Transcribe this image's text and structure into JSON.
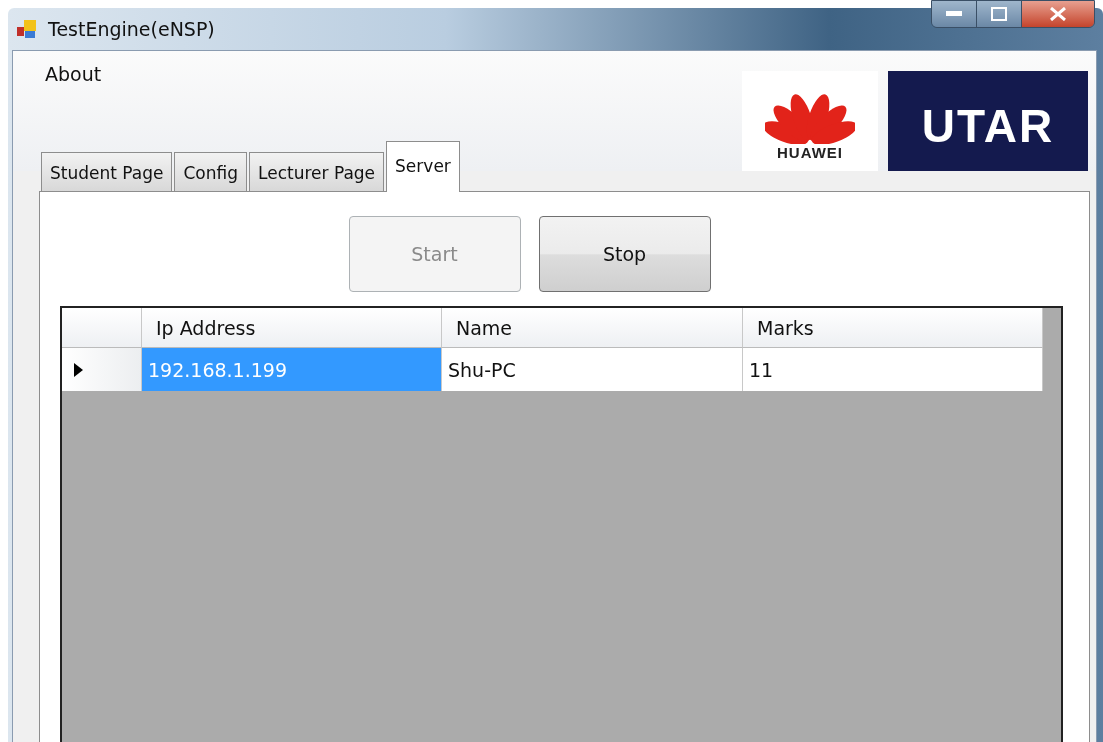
{
  "window": {
    "title": "TestEngine(eNSP)"
  },
  "menu": [
    "About"
  ],
  "logos": [
    {
      "kind": "huawei",
      "text": "HUAWEI"
    },
    {
      "kind": "utar",
      "text": "UTAR"
    }
  ],
  "tabs": [
    {
      "label": "Student Page",
      "selected": false
    },
    {
      "label": "Config",
      "selected": false
    },
    {
      "label": "Lecturer Page",
      "selected": false
    },
    {
      "label": "Server",
      "selected": true
    }
  ],
  "buttons": [
    {
      "label": "Start",
      "disabled": true
    },
    {
      "label": "Stop",
      "disabled": false
    }
  ],
  "table": {
    "columns": [
      "Ip Address",
      "Name",
      "Marks"
    ],
    "rows": [
      {
        "current": true,
        "cells": [
          {
            "text": "192.168.1.199",
            "selected": true
          },
          {
            "text": "Shu-PC",
            "selected": false
          },
          {
            "text": "11",
            "selected": false
          }
        ]
      }
    ]
  }
}
